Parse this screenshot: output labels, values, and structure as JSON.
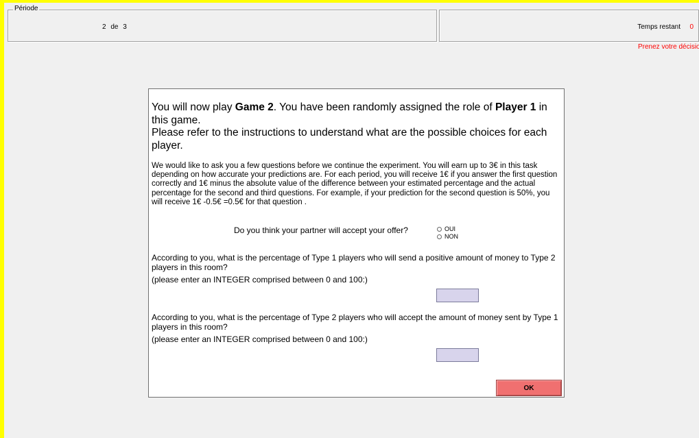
{
  "header": {
    "period_legend": "Période",
    "period_text": "2 de 3",
    "time_label": "Temps restant",
    "time_value": "0",
    "warning": "Prenez votre décision"
  },
  "dialog": {
    "intro_1": "You will now play ",
    "intro_game": "Game 2",
    "intro_2": ". You have been randomly assigned the role of ",
    "intro_player": "Player 1",
    "intro_3": " in this game.",
    "intro_line2": "Please refer to the instructions to understand what are the possible choices for each player.",
    "paragraph": "We would like to ask you a few questions before we continue the experiment. You will earn up to 3€ in this task depending on how accurate your predictions are. For each period, you will receive 1€ if you answer the first question correctly and 1€ minus the absolute value of the difference between your estimated percentage and the actual percentage for the second and third questions. For example, if your prediction for the second question is 50%, you will receive 1€ -0.5€ =0.5€ for that question .",
    "question1": "Do you think your partner will accept your offer?",
    "option_yes": "OUI",
    "option_no": "NON",
    "question2": "According to you, what is the percentage of Type 1 players who will send a positive amount of money to Type 2 players in this room?",
    "question2_hint": "(please enter an INTEGER comprised between 0 and 100:)",
    "question3": "According to you, what is the percentage of Type 2 players who will accept the amount of money sent by Type 1 players in this room?",
    "question3_hint": "(please enter an INTEGER comprised between 0 and 100:)",
    "input1_value": "",
    "input2_value": "",
    "ok_label": "OK"
  },
  "colors": {
    "frame": "#ffff00",
    "warning": "#ff0000",
    "input_bg": "#d8d4ec",
    "ok_button": "#f07070"
  }
}
